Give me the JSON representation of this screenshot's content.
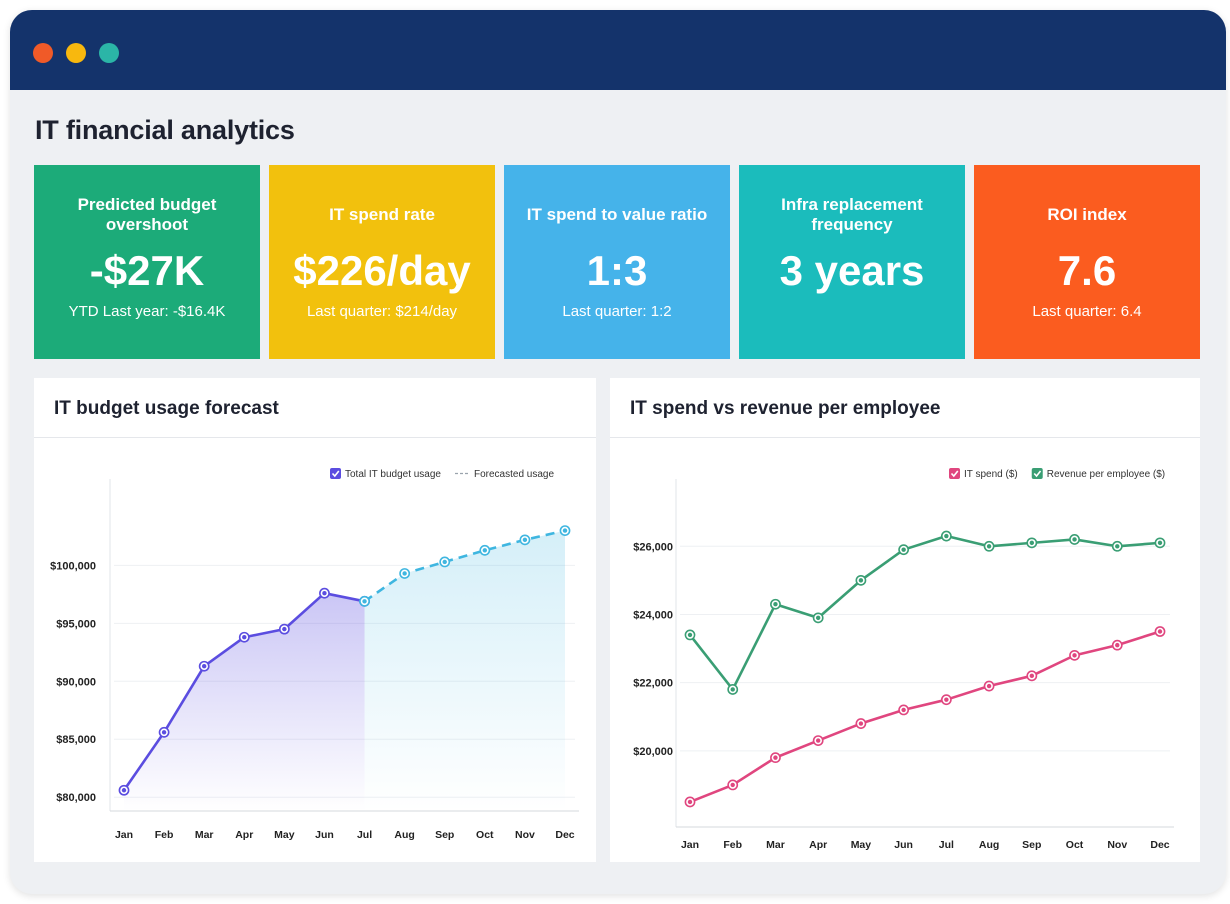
{
  "window": {
    "title": "IT financial analytics"
  },
  "kpis": [
    {
      "label": "Predicted budget overshoot",
      "value": "-$27K",
      "sub": "YTD Last year: -$16.4K",
      "color": "#1cab79"
    },
    {
      "label": "IT spend rate",
      "value": "$226/day",
      "sub": "Last quarter: $214/day",
      "color": "#f2c10d"
    },
    {
      "label": "IT spend to value ratio",
      "value": "1:3",
      "sub": "Last quarter: 1:2",
      "color": "#45b3ea"
    },
    {
      "label": "Infra replacement frequency",
      "value": "3 years",
      "sub": "",
      "color": "#1bbcbc"
    },
    {
      "label": "ROI index",
      "value": "7.6",
      "sub": "Last quarter: 6.4",
      "color": "#fb5c1f"
    }
  ],
  "panels": {
    "left_title": "IT budget usage forecast",
    "right_title": "IT spend vs revenue per employee"
  },
  "chart_data": [
    {
      "type": "line",
      "title": "IT budget usage forecast",
      "categories": [
        "Jan",
        "Feb",
        "Mar",
        "Apr",
        "May",
        "Jun",
        "Jul",
        "Aug",
        "Sep",
        "Oct",
        "Nov",
        "Dec"
      ],
      "series": [
        {
          "name": "Total IT budget usage",
          "color": "#5b4de0",
          "values": [
            80600,
            85600,
            91300,
            93800,
            94500,
            97600,
            96900,
            null,
            null,
            null,
            null,
            null
          ]
        },
        {
          "name": "Forecasted usage",
          "color": "#3fb6e0",
          "dashed": true,
          "values": [
            null,
            null,
            null,
            null,
            null,
            null,
            96900,
            99300,
            100300,
            101300,
            102200,
            103000
          ]
        }
      ],
      "yticks": [
        80000,
        85000,
        90000,
        95000,
        100000
      ],
      "ytick_labels": [
        "$80,000",
        "$85,000",
        "$90,000",
        "$95,000",
        "$100,000"
      ],
      "ylim": [
        79500,
        104000
      ],
      "grid": true,
      "legend": "top-right"
    },
    {
      "type": "line",
      "title": "IT spend vs revenue per employee",
      "categories": [
        "Jan",
        "Feb",
        "Mar",
        "Apr",
        "May",
        "Jun",
        "Jul",
        "Aug",
        "Sep",
        "Oct",
        "Nov",
        "Dec"
      ],
      "series": [
        {
          "name": "IT spend ($)",
          "color": "#e0467f",
          "values": [
            18500,
            19000,
            19800,
            20300,
            20800,
            21200,
            21500,
            21900,
            22200,
            22800,
            23100,
            23500
          ]
        },
        {
          "name": "Revenue per employee ($)",
          "color": "#3a9e74",
          "values": [
            23400,
            21800,
            24300,
            23900,
            25000,
            25900,
            26300,
            26000,
            26100,
            26200,
            26000,
            26100
          ]
        }
      ],
      "yticks": [
        20000,
        22000,
        24000,
        26000
      ],
      "ytick_labels": [
        "$20,000",
        "$22,000",
        "$24,000",
        "$26,000"
      ],
      "ylim": [
        18000,
        26800
      ],
      "grid": true,
      "legend": "top-right"
    }
  ]
}
